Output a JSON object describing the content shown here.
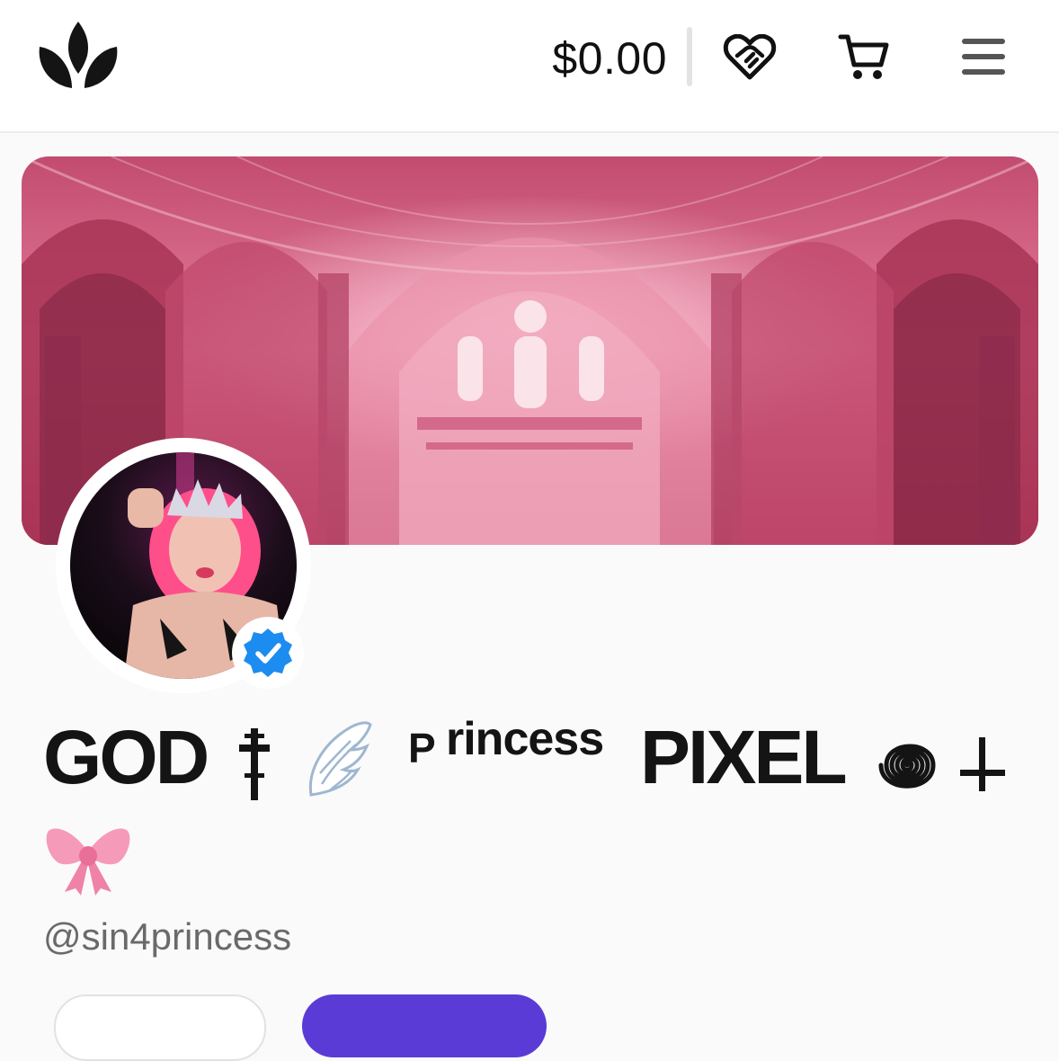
{
  "header": {
    "logo_icon": "crown-logo-icon",
    "balance": "$0.00",
    "icons": [
      "heart-handshake-icon",
      "cart-icon",
      "hamburger-menu-icon"
    ]
  },
  "profile": {
    "banner_image": "pink-gothic-cathedral-interior",
    "avatar_image": "profile-photo",
    "verified_icon": "verified-badge-icon",
    "display_name": {
      "part1": "GOD",
      "part2": "P",
      "part3": "rincess",
      "part4": "PIXEL"
    },
    "name_emoji": [
      "cross-icon",
      "angel-wing-icon",
      "spiral-icon",
      "inverted-cross-icon",
      "pink-bow-icon"
    ],
    "handle": "@sin4princess"
  },
  "colors": {
    "accent": "#5b3bd6",
    "verified": "#1d8cf0",
    "banner_tint": "#e05a86"
  }
}
